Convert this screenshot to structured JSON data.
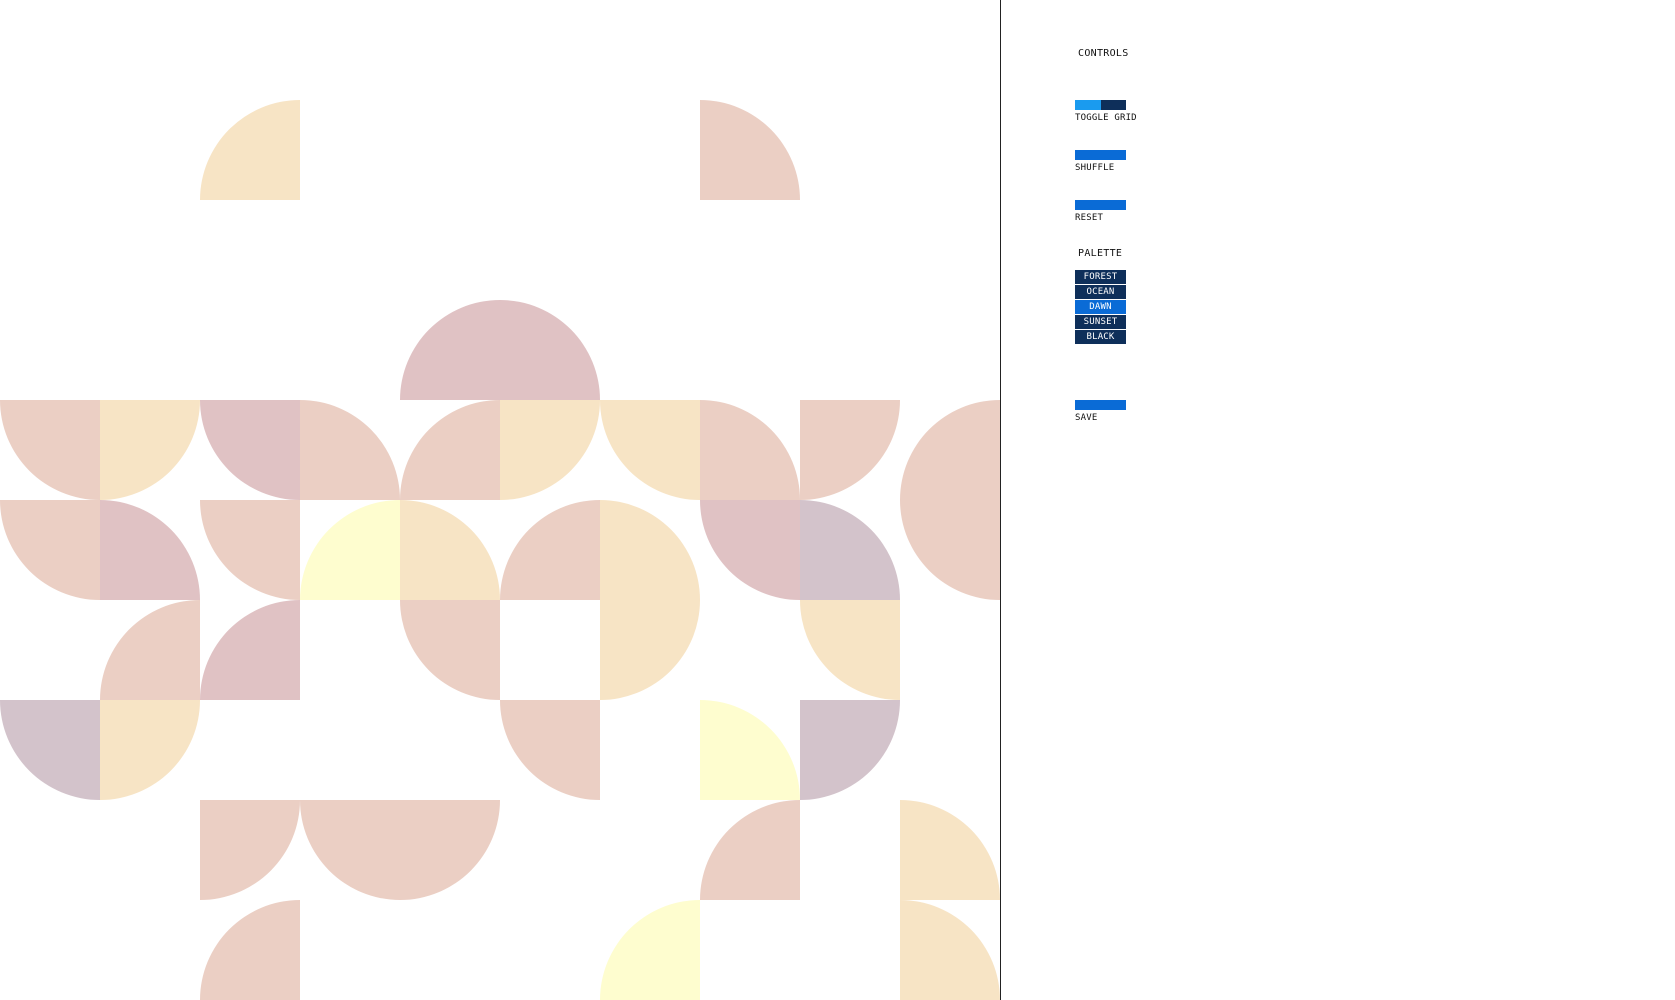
{
  "controls": {
    "heading": "CONTROLS",
    "toggle_grid_label": "TOGGLE GRID",
    "shuffle_label": "SHUFFLE",
    "reset_label": "RESET",
    "save_label": "SAVE"
  },
  "palette": {
    "heading": "PALETTE",
    "options": [
      "FOREST",
      "OCEAN",
      "DAWN",
      "SUNSET",
      "BLACK"
    ],
    "selected": "DAWN"
  },
  "colors": {
    "button": "#0A6BD6",
    "button_dark": "#0E2F5A",
    "toggle_on": "#1A9BEF",
    "selected": "#0A6BD6",
    "tile_palette": [
      "#EBCFC4",
      "#F7E4C5",
      "#E0C2C4",
      "#D3C3CB",
      "#FEFDCF"
    ]
  },
  "grid": {
    "columns": 10,
    "rows": 10
  },
  "tiles": [
    {
      "c": 2,
      "r": 1,
      "type": "q",
      "corner": "br",
      "color": 1
    },
    {
      "c": 7,
      "r": 1,
      "type": "q",
      "corner": "bl",
      "color": 0
    },
    {
      "c": 4,
      "r": 3,
      "type": "h2",
      "dir": "up",
      "color": 2
    },
    {
      "c": 0,
      "r": 4,
      "type": "q",
      "corner": "tr",
      "color": 0
    },
    {
      "c": 1,
      "r": 4,
      "type": "q",
      "corner": "tl",
      "color": 1
    },
    {
      "c": 2,
      "r": 4,
      "type": "q",
      "corner": "tr",
      "color": 2
    },
    {
      "c": 3,
      "r": 4,
      "type": "q",
      "corner": "bl",
      "color": 0
    },
    {
      "c": 4,
      "r": 4,
      "type": "q",
      "corner": "br",
      "color": 0
    },
    {
      "c": 5,
      "r": 4,
      "type": "q",
      "corner": "tl",
      "color": 1
    },
    {
      "c": 6,
      "r": 4,
      "type": "q",
      "corner": "tr",
      "color": 1
    },
    {
      "c": 7,
      "r": 4,
      "type": "q",
      "corner": "bl",
      "color": 0
    },
    {
      "c": 8,
      "r": 4,
      "type": "q",
      "corner": "tl",
      "color": 0
    },
    {
      "c": 9,
      "r": 4,
      "type": "h2",
      "dir": "left",
      "color": 0
    },
    {
      "c": 0,
      "r": 5,
      "type": "q",
      "corner": "tr",
      "color": 0
    },
    {
      "c": 1,
      "r": 5,
      "type": "q",
      "corner": "bl",
      "color": 2
    },
    {
      "c": 2,
      "r": 5,
      "type": "q",
      "corner": "tr",
      "color": 0
    },
    {
      "c": 3,
      "r": 5,
      "type": "q",
      "corner": "br",
      "color": 4
    },
    {
      "c": 4,
      "r": 5,
      "type": "q",
      "corner": "bl",
      "color": 1
    },
    {
      "c": 5,
      "r": 5,
      "type": "q",
      "corner": "br",
      "color": 0
    },
    {
      "c": 6,
      "r": 5,
      "type": "h2",
      "dir": "down",
      "color": 1
    },
    {
      "c": 7,
      "r": 5,
      "type": "q",
      "corner": "tr",
      "color": 2
    },
    {
      "c": 8,
      "r": 5,
      "type": "q",
      "corner": "bl",
      "color": 3
    },
    {
      "c": 1,
      "r": 6,
      "type": "q",
      "corner": "br",
      "color": 0
    },
    {
      "c": 2,
      "r": 6,
      "type": "q",
      "corner": "br",
      "color": 2
    },
    {
      "c": 4,
      "r": 6,
      "type": "q",
      "corner": "tr",
      "color": 0
    },
    {
      "c": 8,
      "r": 6,
      "type": "q",
      "corner": "tr",
      "color": 1
    },
    {
      "c": 0,
      "r": 7,
      "type": "q",
      "corner": "tr",
      "color": 3
    },
    {
      "c": 1,
      "r": 7,
      "type": "q",
      "corner": "tl",
      "color": 1
    },
    {
      "c": 5,
      "r": 7,
      "type": "q",
      "corner": "tr",
      "color": 0
    },
    {
      "c": 7,
      "r": 7,
      "type": "q",
      "corner": "bl",
      "color": 4
    },
    {
      "c": 8,
      "r": 7,
      "type": "q",
      "corner": "tl",
      "color": 3
    },
    {
      "c": 2,
      "r": 8,
      "type": "q",
      "corner": "tl",
      "color": 0
    },
    {
      "c": 3,
      "r": 8,
      "type": "h2",
      "dir": "down",
      "color": 0
    },
    {
      "c": 7,
      "r": 8,
      "type": "q",
      "corner": "br",
      "color": 0
    },
    {
      "c": 9,
      "r": 8,
      "type": "q",
      "corner": "bl",
      "color": 1
    },
    {
      "c": 2,
      "r": 9,
      "type": "q",
      "corner": "br",
      "color": 0
    },
    {
      "c": 6,
      "r": 9,
      "type": "q",
      "corner": "br",
      "color": 4
    },
    {
      "c": 9,
      "r": 9,
      "type": "q",
      "corner": "bl",
      "color": 1
    }
  ]
}
